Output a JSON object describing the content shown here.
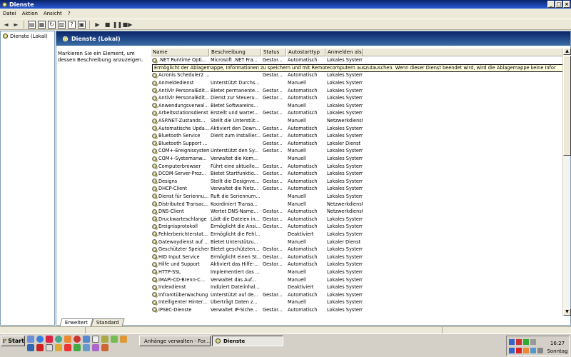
{
  "window": {
    "title": "Dienste"
  },
  "menu": [
    "Datei",
    "Aktion",
    "Ansicht",
    "?"
  ],
  "tree": {
    "root_label": "Dienste (Lokal)"
  },
  "panel": {
    "header": "Dienste (Lokal)",
    "description": "Markieren Sie ein Element, um dessen Beschreibung anzuzeigen."
  },
  "columns": [
    "Name",
    "Beschreibung",
    "Status",
    "Autostarttyp",
    "Anmelden als"
  ],
  "tooltip": "Ermöglicht der Ablagemappe, Informationen zu speichern und mit Remotecomputern auszutauschen. Wenn dieser Dienst beendet wird, wird die Ablagemappe keine Infor",
  "services": [
    {
      "name": ".NET Runtime Opti...",
      "desc": "Microsoft .NET Fra...",
      "status": "Gestar...",
      "start": "Automatisch",
      "logon": "Lokales System"
    },
    {
      "name": "Ablagemappe",
      "desc": "",
      "status": "",
      "start": "",
      "logon": ""
    },
    {
      "name": "Acronis Scheduler2 ...",
      "desc": "",
      "status": "Gestar...",
      "start": "Automatisch",
      "logon": "Lokales System"
    },
    {
      "name": "Anmeldedienst",
      "desc": "Unterstützt Durchs...",
      "status": "",
      "start": "Manuell",
      "logon": "Lokales System"
    },
    {
      "name": "AntiVir PersonalEdit...",
      "desc": "Bietet permanente...",
      "status": "Gestar...",
      "start": "Automatisch",
      "logon": "Lokales System"
    },
    {
      "name": "AntiVir PersonalEdit...",
      "desc": "Dienst zur Steueru...",
      "status": "Gestar...",
      "start": "Automatisch",
      "logon": "Lokales System"
    },
    {
      "name": "Anwendungsverwal...",
      "desc": "Bietet Softwareins...",
      "status": "",
      "start": "Manuell",
      "logon": "Lokales System"
    },
    {
      "name": "Arbeitsstationsdienst",
      "desc": "Erstellt und wartet...",
      "status": "Gestar...",
      "start": "Automatisch",
      "logon": "Lokales System"
    },
    {
      "name": "ASP.NET-Zustands...",
      "desc": "Stellt die Unterstüt...",
      "status": "",
      "start": "Manuell",
      "logon": "Netzwerkdienst"
    },
    {
      "name": "Automatische Upda...",
      "desc": "Aktiviert den Down...",
      "status": "Gestar...",
      "start": "Automatisch",
      "logon": "Lokales System"
    },
    {
      "name": "Bluetooth Service",
      "desc": "Dient zum Installier...",
      "status": "Gestar...",
      "start": "Automatisch",
      "logon": "Lokales System"
    },
    {
      "name": "Bluetooth Support ...",
      "desc": "",
      "status": "Gestar...",
      "start": "Automatisch",
      "logon": "Lokaler Dienst"
    },
    {
      "name": "COM+-Ereignissystem",
      "desc": "Unterstützt den Sy...",
      "status": "Gestar...",
      "start": "Manuell",
      "logon": "Lokales System"
    },
    {
      "name": "COM+-Systemanw...",
      "desc": "Verwaltet die Kom...",
      "status": "",
      "start": "Manuell",
      "logon": "Lokales System"
    },
    {
      "name": "Computerbrowser",
      "desc": "Führt eine aktuelle...",
      "status": "Gestar...",
      "start": "Automatisch",
      "logon": "Lokales System"
    },
    {
      "name": "DCOM-Server-Proz...",
      "desc": "Bietet Startfunktio...",
      "status": "Gestar...",
      "start": "Automatisch",
      "logon": "Lokales System"
    },
    {
      "name": "Designs",
      "desc": "Stellt die Designve...",
      "status": "Gestar...",
      "start": "Automatisch",
      "logon": "Lokales System"
    },
    {
      "name": "DHCP-Client",
      "desc": "Verwaltet die Netz...",
      "status": "Gestar...",
      "start": "Automatisch",
      "logon": "Lokales System"
    },
    {
      "name": "Dienst für Seriennu...",
      "desc": "Ruft die Seriennum...",
      "status": "",
      "start": "Manuell",
      "logon": "Lokales System"
    },
    {
      "name": "Distributed Transac...",
      "desc": "Koordiniert Transa...",
      "status": "",
      "start": "Manuell",
      "logon": "Netzwerkdienst"
    },
    {
      "name": "DNS-Client",
      "desc": "Wertet DNS-Name...",
      "status": "Gestar...",
      "start": "Automatisch",
      "logon": "Netzwerkdienst"
    },
    {
      "name": "Druckwarteschlange",
      "desc": "Lädt die Dateien in...",
      "status": "Gestar...",
      "start": "Automatisch",
      "logon": "Lokales System"
    },
    {
      "name": "Ereignisprotokoll",
      "desc": "Ermöglicht die Ansi...",
      "status": "Gestar...",
      "start": "Automatisch",
      "logon": "Lokales System"
    },
    {
      "name": "Fehlerberichterstat...",
      "desc": "Ermöglicht die Fehl...",
      "status": "",
      "start": "Deaktiviert",
      "logon": "Lokales System"
    },
    {
      "name": "Gatewaydienst auf ...",
      "desc": "Bietet Unterstützu...",
      "status": "",
      "start": "Manuell",
      "logon": "Lokaler Dienst"
    },
    {
      "name": "Geschützter Speicher",
      "desc": "Bietet geschützten...",
      "status": "Gestar...",
      "start": "Automatisch",
      "logon": "Lokales System"
    },
    {
      "name": "HID Input Service",
      "desc": "Ermöglicht einen St...",
      "status": "Gestar...",
      "start": "Automatisch",
      "logon": "Lokales System"
    },
    {
      "name": "Hilfe und Support",
      "desc": "Aktiviert das Hilfe-...",
      "status": "Gestar...",
      "start": "Automatisch",
      "logon": "Lokales System"
    },
    {
      "name": "HTTP-SSL",
      "desc": "Implementiert das ...",
      "status": "",
      "start": "Manuell",
      "logon": "Lokales System"
    },
    {
      "name": "IMAPI-CD-Brenn-C...",
      "desc": "Verwaltet das Auf...",
      "status": "",
      "start": "Manuell",
      "logon": "Lokales System"
    },
    {
      "name": "Indexdienst",
      "desc": "Indiziert Dateiinhal...",
      "status": "",
      "start": "Deaktiviert",
      "logon": "Lokales System"
    },
    {
      "name": "Infrarotüberwachung",
      "desc": "Unterstützt auf de...",
      "status": "Gestar...",
      "start": "Automatisch",
      "logon": "Lokales System"
    },
    {
      "name": "Intelligenter Hinter...",
      "desc": "Überträgt Daten z...",
      "status": "",
      "start": "Manuell",
      "logon": "Lokales System"
    },
    {
      "name": "IPSEC-Dienste",
      "desc": "Verwaltet IP-Siche...",
      "status": "Gestar...",
      "start": "Automatisch",
      "logon": "Lokales System"
    }
  ],
  "tabs": [
    "Erweitert",
    "Standard"
  ],
  "taskbar": {
    "start_label": "Start",
    "tasks": [
      "Anhänge verwalten - For...",
      "Dienste"
    ],
    "clock_time": "16:27",
    "clock_day": "Sonntag"
  },
  "colors": {
    "title_blue": "#0a246a",
    "panel_bg": "#ece9d8",
    "tooltip_bg": "#ffffe1"
  }
}
